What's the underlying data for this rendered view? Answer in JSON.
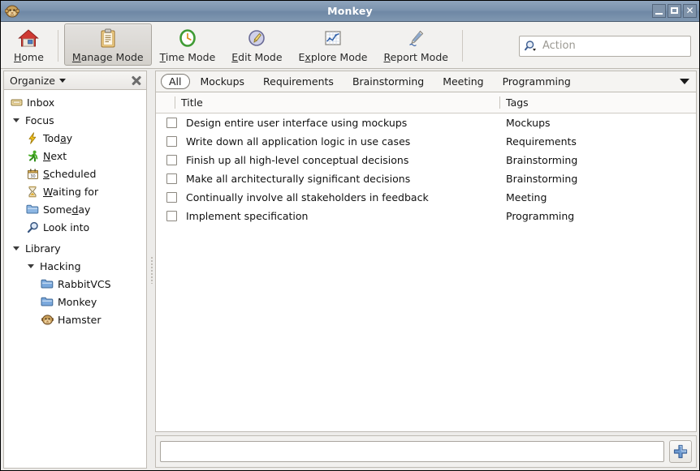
{
  "window": {
    "title": "Monkey",
    "app_icon": "monkey-icon",
    "buttons": {
      "minimize": "minimize-icon",
      "maximize": "maximize-icon",
      "close": "close-icon"
    }
  },
  "toolbar": {
    "items": [
      {
        "id": "home",
        "label": "Home",
        "mnemonic": "H",
        "icon": "house-icon",
        "active": false
      },
      {
        "id": "manage-mode",
        "label": "Manage Mode",
        "mnemonic": "M",
        "icon": "clipboard-icon",
        "active": true
      },
      {
        "id": "time-mode",
        "label": "Time Mode",
        "mnemonic": "T",
        "icon": "clock-icon",
        "active": false
      },
      {
        "id": "edit-mode",
        "label": "Edit Mode",
        "mnemonic": "E",
        "icon": "pencil-circle-icon",
        "active": false
      },
      {
        "id": "explore-mode",
        "label": "Explore Mode",
        "mnemonic": "x",
        "icon": "chart-icon",
        "active": false
      },
      {
        "id": "report-mode",
        "label": "Report Mode",
        "mnemonic": "R",
        "icon": "pen-icon",
        "active": false
      }
    ],
    "action": {
      "icon": "search-dropdown-icon",
      "placeholder": "Action",
      "value": ""
    }
  },
  "sidebar": {
    "header": {
      "label": "Organize",
      "dropdown_icon": "chevron-down-icon",
      "close_icon": "close-icon"
    },
    "tree": [
      {
        "label": "Inbox",
        "indent": 0,
        "icon": "inbox-icon",
        "twisty": "",
        "mnemonic": ""
      },
      {
        "label": "Focus",
        "indent": 1,
        "icon": "",
        "twisty": "down",
        "mnemonic": ""
      },
      {
        "label": "Today",
        "indent": 2,
        "icon": "lightning-icon",
        "twisty": "",
        "mnemonic": "a"
      },
      {
        "label": "Next",
        "indent": 2,
        "icon": "runner-icon",
        "twisty": "",
        "mnemonic": "N"
      },
      {
        "label": "Scheduled",
        "indent": 2,
        "icon": "calendar-icon",
        "twisty": "",
        "mnemonic": "S"
      },
      {
        "label": "Waiting for",
        "indent": 2,
        "icon": "hourglass-icon",
        "twisty": "",
        "mnemonic": "W"
      },
      {
        "label": "Someday",
        "indent": 2,
        "icon": "folder-icon",
        "twisty": "",
        "mnemonic": "d"
      },
      {
        "label": "Look into",
        "indent": 2,
        "icon": "magnifier-icon",
        "twisty": "",
        "mnemonic": ""
      },
      {
        "label": "Library",
        "indent": 1,
        "icon": "",
        "twisty": "down",
        "mnemonic": ""
      },
      {
        "label": "Hacking",
        "indent": 2,
        "icon": "",
        "twisty": "down",
        "mnemonic": ""
      },
      {
        "label": "RabbitVCS",
        "indent": 3,
        "icon": "folder-blue-icon",
        "twisty": "",
        "mnemonic": ""
      },
      {
        "label": "Monkey",
        "indent": 3,
        "icon": "folder-blue-icon",
        "twisty": "",
        "mnemonic": ""
      },
      {
        "label": "Hamster",
        "indent": 3,
        "icon": "monkey-icon",
        "twisty": "",
        "mnemonic": ""
      }
    ]
  },
  "main": {
    "tags_filter": {
      "chips": [
        {
          "label": "All",
          "selected": true
        },
        {
          "label": "Mockups",
          "selected": false
        },
        {
          "label": "Requirements",
          "selected": false
        },
        {
          "label": "Brainstorming",
          "selected": false
        },
        {
          "label": "Meeting",
          "selected": false
        },
        {
          "label": "Programming",
          "selected": false
        }
      ],
      "more_icon": "chevron-down-icon"
    },
    "list": {
      "columns": [
        "Title",
        "Tags"
      ],
      "rows": [
        {
          "checked": false,
          "title": "Design entire user interface using mockups",
          "tags": "Mockups"
        },
        {
          "checked": false,
          "title": "Write down all application logic in use cases",
          "tags": "Requirements"
        },
        {
          "checked": false,
          "title": "Finish up all high-level conceptual decisions",
          "tags": "Brainstorming"
        },
        {
          "checked": false,
          "title": "Make all architecturally significant decisions",
          "tags": "Brainstorming"
        },
        {
          "checked": false,
          "title": "Continually involve all stakeholders in feedback",
          "tags": "Meeting"
        },
        {
          "checked": false,
          "title": "Implement specification",
          "tags": "Programming"
        }
      ]
    },
    "entry": {
      "value": "",
      "placeholder": "",
      "add_icon": "plus-icon"
    }
  },
  "colors": {
    "titlebar": "#7b93ae",
    "toolbar_bg": "#f2f1ef",
    "window_bg": "#edecea",
    "list_bg": "#ffffff",
    "border": "#bfbbb4",
    "accent_plus": "#5a8bc4"
  }
}
